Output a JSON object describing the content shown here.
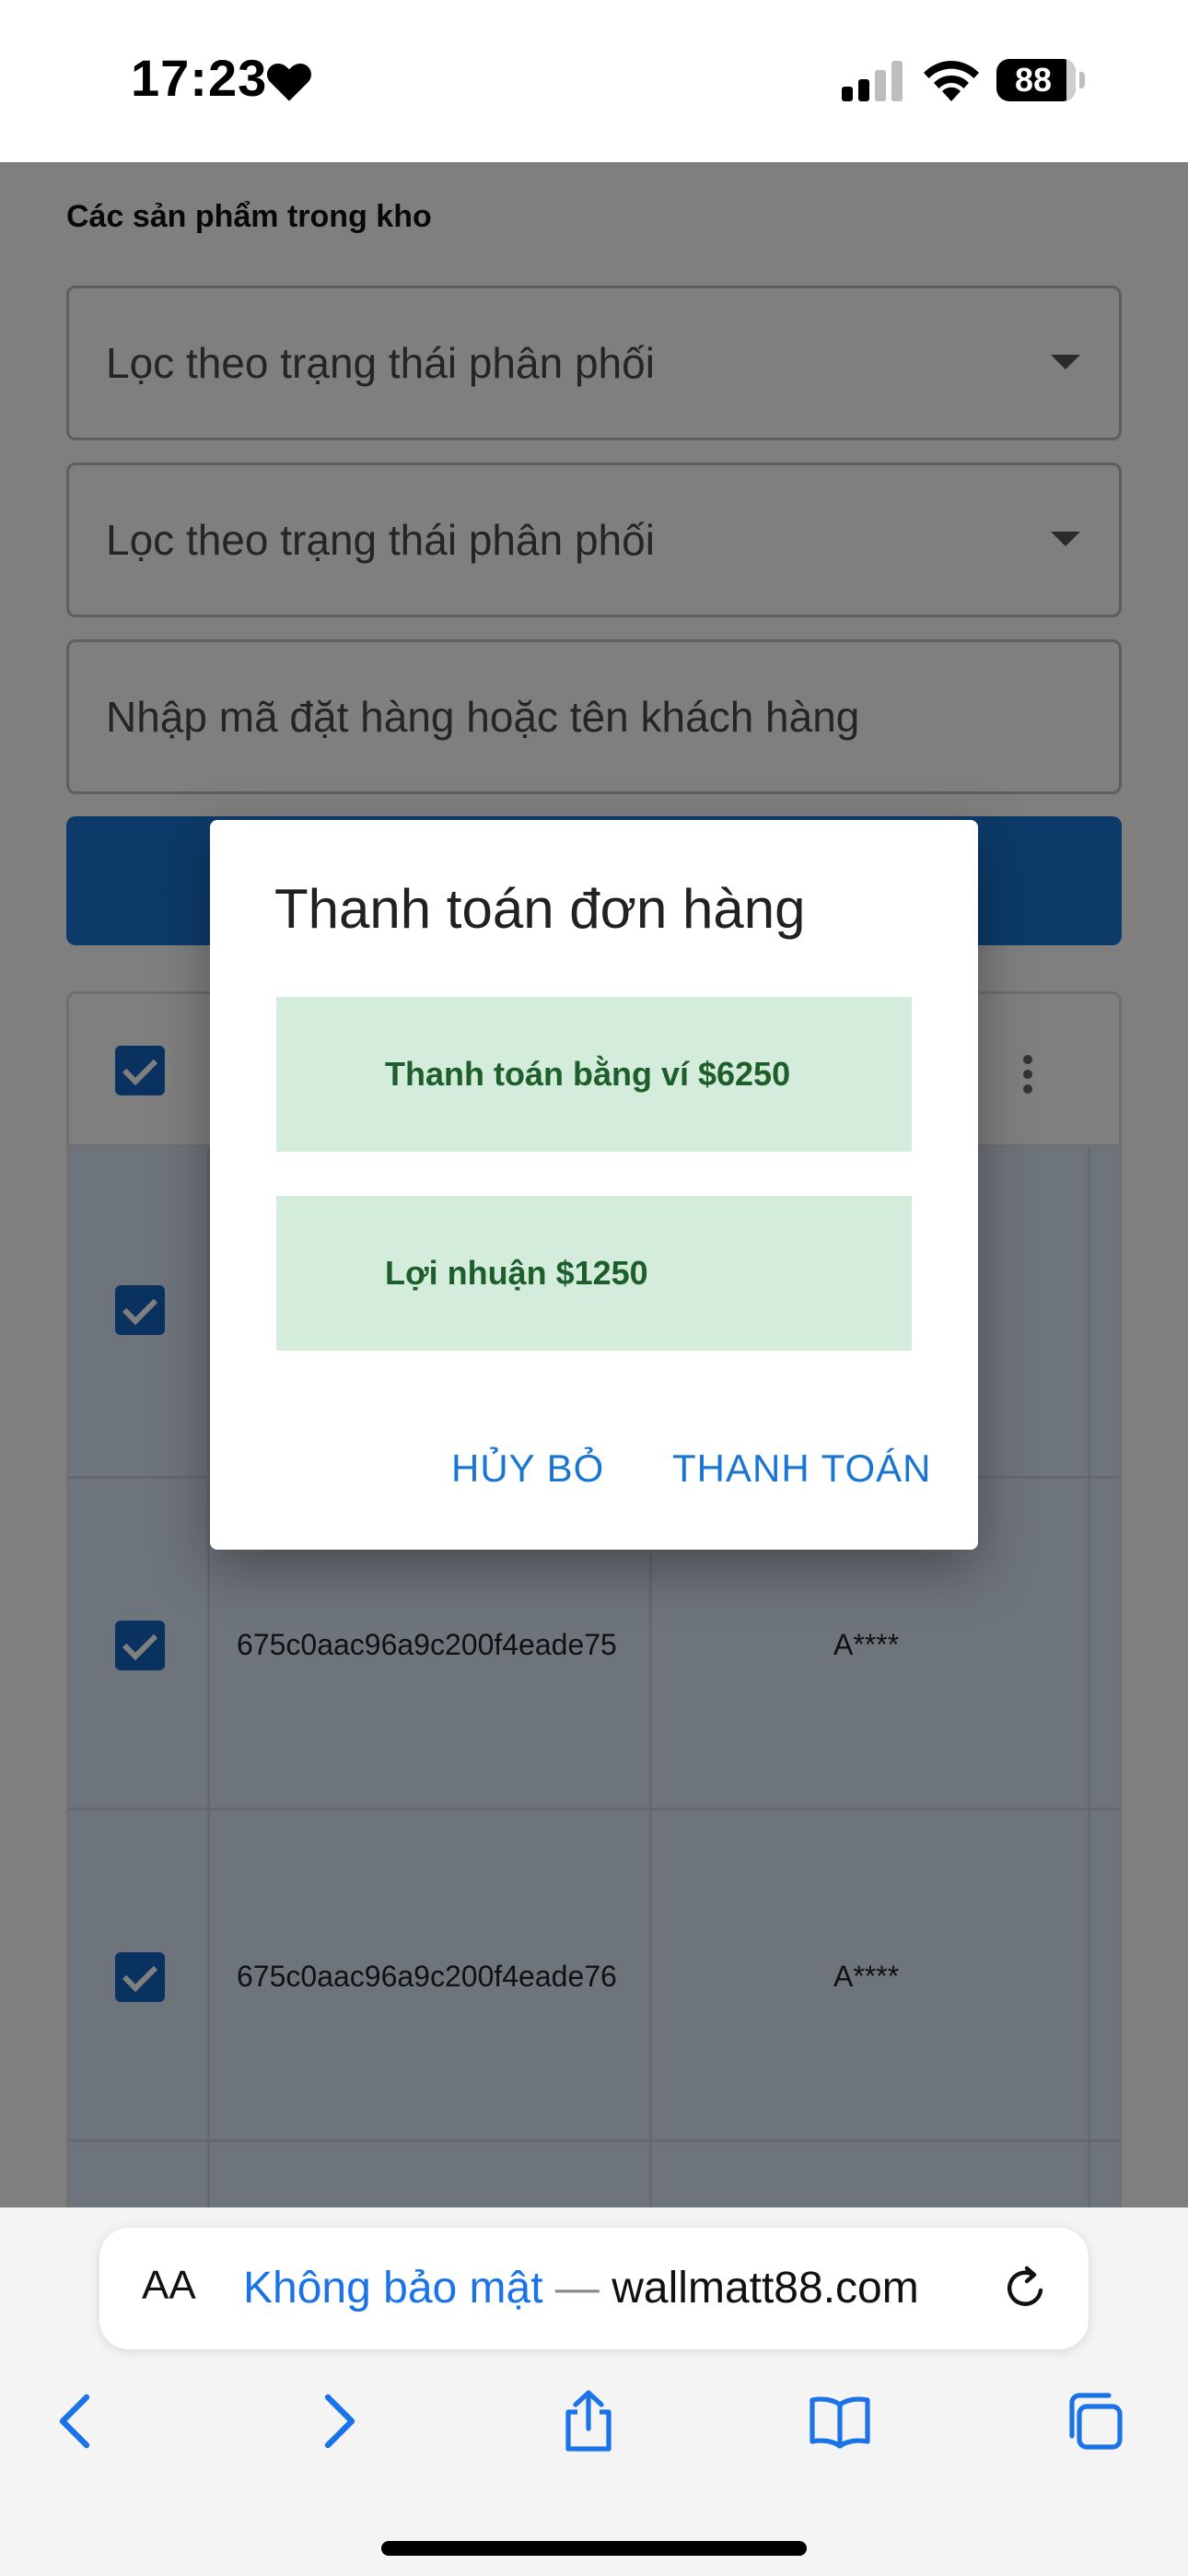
{
  "status_bar": {
    "time": "17:23",
    "battery": "88",
    "icons": [
      "heart-icon",
      "signal-icon",
      "wifi-icon",
      "battery-icon"
    ]
  },
  "page": {
    "section_title": "Các sản phẩm trong kho",
    "filter_1": "Lọc theo trạng thái phân phối",
    "filter_2": "Lọc theo trạng thái phân phối",
    "search_placeholder": "Nhập mã đặt hàng hoặc tên khách hàng",
    "rows": [
      {
        "id": "",
        "name": ""
      },
      {
        "id": "675c0aac96a9c200f4eade75",
        "name": "A****"
      },
      {
        "id": "675c0aac96a9c200f4eade76",
        "name": "A****"
      }
    ]
  },
  "dialog": {
    "title": "Thanh toán đơn hàng",
    "wallet_payment": "Thanh toán bằng ví $6250",
    "profit": "Lợi nhuận $1250",
    "cancel_label": "HỦY BỎ",
    "pay_label": "THANH TOÁN"
  },
  "browser": {
    "aa_label": "AA",
    "insecure_label": "Không bảo mật",
    "separator": "—",
    "domain": "wallmatt88.com"
  },
  "colors": {
    "primary": "#1976d2",
    "checkbox": "#1565c0",
    "pay_box_bg": "#d4ecdb",
    "pay_box_text": "#1d5e2b",
    "url_link": "#1a73e8"
  }
}
